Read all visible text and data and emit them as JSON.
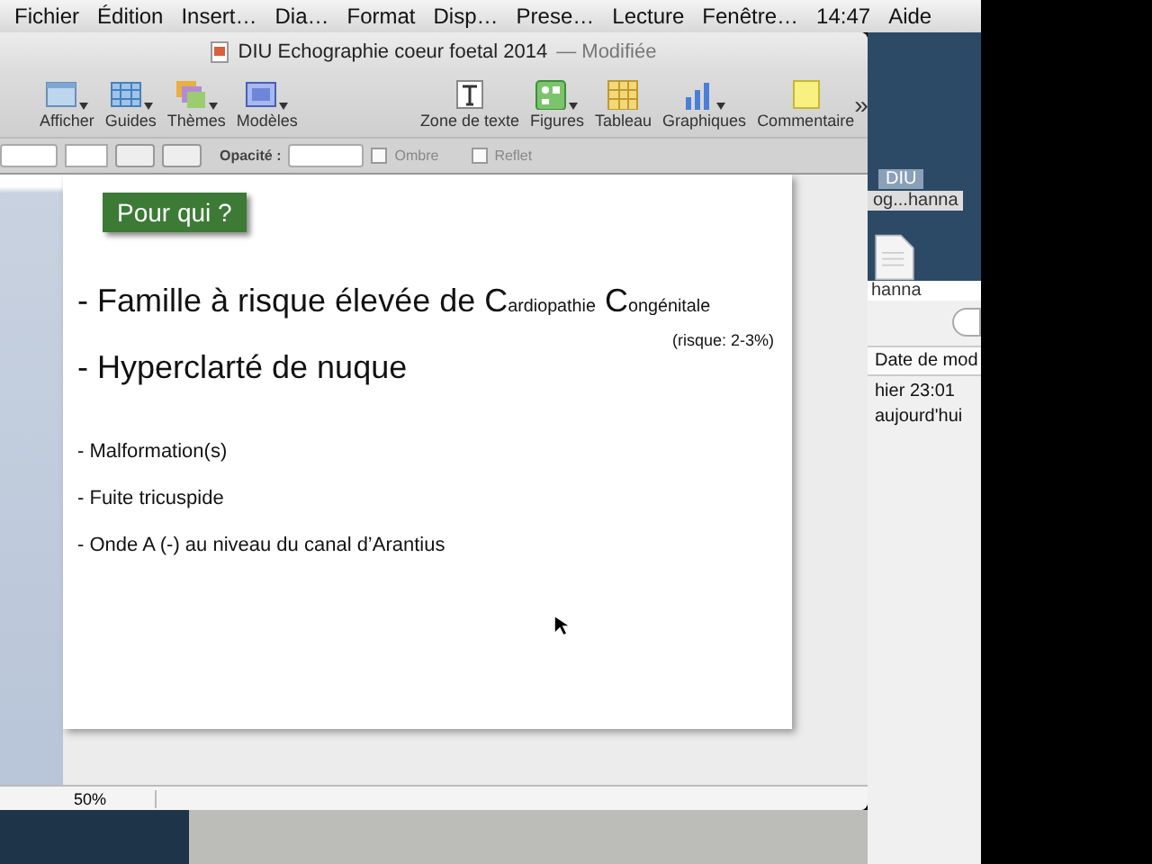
{
  "menu_bar": {
    "items": [
      "Fichier",
      "Édition",
      "Insert…",
      "Dia…",
      "Format",
      "Disp…",
      "Prese…",
      "Lecture",
      "Fenêtre…",
      "14:47",
      "Aide"
    ]
  },
  "window": {
    "title": "DIU Echographie coeur foetal 2014",
    "status": "— Modifiée"
  },
  "toolbar": {
    "left": [
      {
        "label": "Afficher",
        "menu": true
      },
      {
        "label": "Guides",
        "menu": true
      },
      {
        "label": "Thèmes",
        "menu": true
      },
      {
        "label": "Modèles",
        "menu": true
      }
    ],
    "right": [
      {
        "label": "Zone de texte",
        "menu": false
      },
      {
        "label": "Figures",
        "menu": true
      },
      {
        "label": "Tableau",
        "menu": false
      },
      {
        "label": "Graphiques",
        "menu": true
      },
      {
        "label": "Commentaire",
        "menu": false
      }
    ],
    "overflow": "»"
  },
  "format_bar": {
    "opacity_label": "Opacité :",
    "checkboxes": [
      {
        "label": "Ombre",
        "checked": false
      },
      {
        "label": "Reflet",
        "checked": false
      }
    ]
  },
  "slide": {
    "title": "Pour qui ?",
    "lines": [
      {
        "kind": "big",
        "runs": [
          {
            "text": "- Famille à risque élevée de C",
            "small": false
          },
          {
            "text": "ardiopathie",
            "small": true
          },
          {
            "text": " C",
            "small": false
          },
          {
            "text": "ongénitale",
            "small": true
          }
        ]
      },
      {
        "kind": "note",
        "runs": [
          {
            "text": "(risque: 2-3%)",
            "small": false
          }
        ]
      },
      {
        "kind": "big",
        "runs": [
          {
            "text": "- Hyperclarté de nuque",
            "small": false
          }
        ]
      },
      {
        "kind": "bullet",
        "runs": [
          {
            "text": "-  Malformation(s)",
            "small": false
          }
        ]
      },
      {
        "kind": "bullet",
        "runs": [
          {
            "text": "-  Fuite tricuspide",
            "small": false
          }
        ]
      },
      {
        "kind": "bullet",
        "runs": [
          {
            "text": "-  Onde A (-) au niveau du canal d’Arantius",
            "small": false
          }
        ]
      }
    ]
  },
  "status_bar": {
    "zoom": "50%"
  },
  "finder": {
    "folder_label_1": "DIU",
    "folder_label_2": "og...hanna",
    "file_label": "hanna",
    "column_header": "Date de mod",
    "dates": [
      "hier 23:01",
      "aujourd'hui"
    ]
  }
}
